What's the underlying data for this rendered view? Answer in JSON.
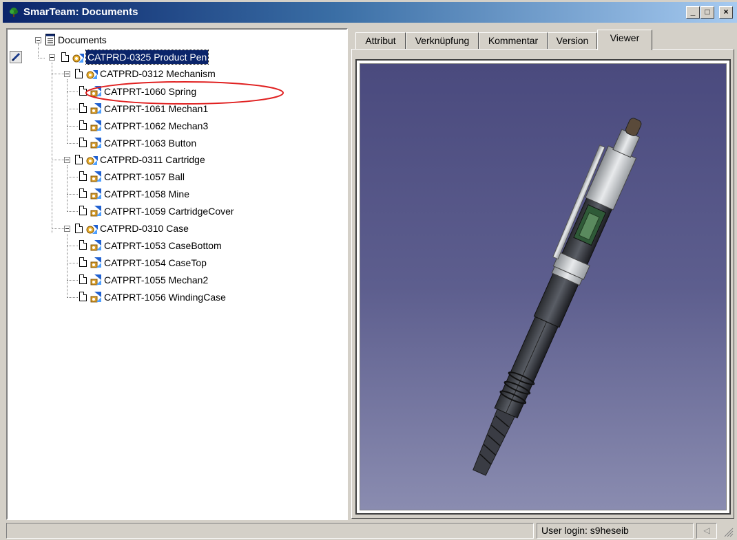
{
  "window": {
    "title": "SmarTeam: Documents",
    "minimize": "_",
    "restore": "□",
    "close": "×"
  },
  "tree": {
    "root": "Documents",
    "product": "CATPRD-0325  Product Pen",
    "mechanism": {
      "label": "CATPRD-0312  Mechanism",
      "items": [
        "CATPRT-1060  Spring",
        "CATPRT-1061  Mechan1",
        "CATPRT-1062  Mechan3",
        "CATPRT-1063  Button"
      ]
    },
    "cartridge": {
      "label": "CATPRD-0311  Cartridge",
      "items": [
        "CATPRT-1057  Ball",
        "CATPRT-1058  Mine",
        "CATPRT-1059  CartridgeCover"
      ]
    },
    "case": {
      "label": "CATPRD-0310  Case",
      "items": [
        "CATPRT-1053  CaseBottom",
        "CATPRT-1054  CaseTop",
        "CATPRT-1055  Mechan2",
        "CATPRT-1056  WindingCase"
      ]
    },
    "highlighted_item": "CATPRT-1060  Spring",
    "highlight_color": "#e02020"
  },
  "tabs": [
    "Attribut",
    "Verknüpfung",
    "Kommentar",
    "Version",
    "Viewer"
  ],
  "active_tab": "Viewer",
  "viewer": {
    "background_top": "#4a4a7e",
    "background_bottom": "#8a8cb0"
  },
  "status": {
    "user_login": "User login: s9heseib",
    "grip": "◁"
  }
}
